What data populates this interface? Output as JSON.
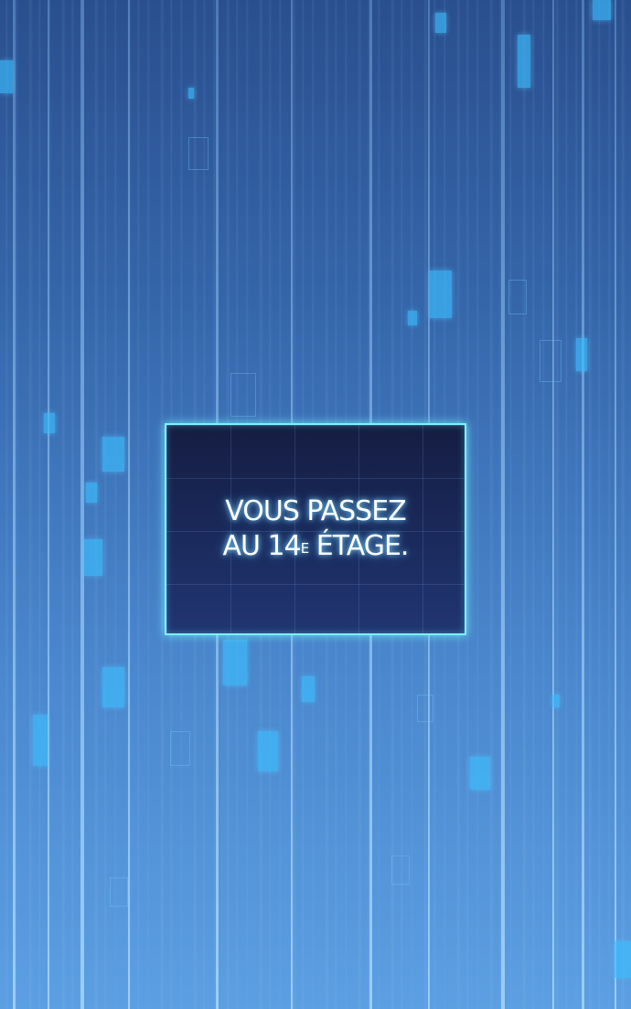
{
  "panel": {
    "line1": "VOUS PASSEZ",
    "line2_before": "AU 14",
    "line2_superscript": "E",
    "line2_after": " ÉTAGE."
  },
  "colors": {
    "background_top": "#2a4f8e",
    "background_bottom": "#5c9fe2",
    "panel_border": "#7ef0ff",
    "panel_fill": "#1b2a5c",
    "particle": "#3cbeff"
  }
}
